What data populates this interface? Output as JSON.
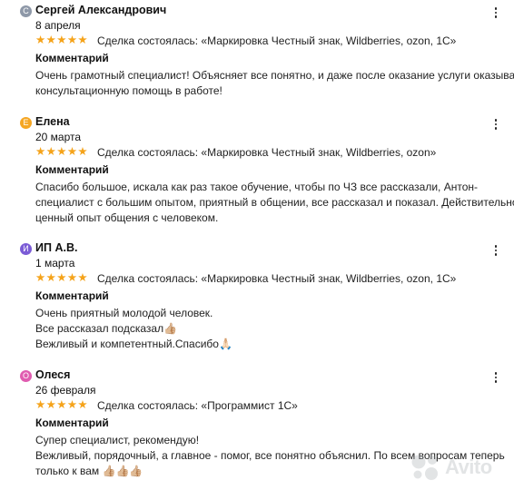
{
  "reviews": [
    {
      "name": "Сергей Александрович",
      "avatar_letter": "С",
      "avatar_color": "#8e98a8",
      "date": "8 апреля",
      "rating": 5,
      "stars": "★★★★★",
      "deal_label": "Сделка состоялась:",
      "deal_value": "«Маркировка Честный знак, Wildberries, ozon, 1С»",
      "comment_title": "Комментарий",
      "lines": [
        "Очень грамотный специалист! Объясняет все понятно, и даже после оказание услуги оказывает",
        "консультационную помощь в работе!"
      ]
    },
    {
      "name": "Елена",
      "avatar_letter": "Е",
      "avatar_color": "#f5a623",
      "date": "20 марта",
      "rating": 5,
      "stars": "★★★★★",
      "deal_label": "Сделка состоялась:",
      "deal_value": "«Маркировка Честный знак, Wildberries, ozon»",
      "comment_title": "Комментарий",
      "lines": [
        "Спасибо большое, искала как раз такое обучение, чтобы по ЧЗ все рассказали, Антон-",
        "специалист с большим опытом, приятный в общении, все рассказал и показал. Действительно",
        "ценный опыт общения с человеком."
      ]
    },
    {
      "name": "ИП А.В.",
      "avatar_letter": "И",
      "avatar_color": "#7b5cd6",
      "date": "1 марта",
      "rating": 5,
      "stars": "★★★★★",
      "deal_label": "Сделка состоялась:",
      "deal_value": "«Маркировка Честный знак, Wildberries, ozon, 1С»",
      "comment_title": "Комментарий",
      "lines": [
        "Очень приятный молодой человек.",
        "Все рассказал подсказал👍🏼",
        "Вежливый и компетентный.Спасибо🙏🏻"
      ]
    },
    {
      "name": "Олеся",
      "avatar_letter": "О",
      "avatar_color": "#e05cb0",
      "date": "26 февраля",
      "rating": 5,
      "stars": "★★★★★",
      "deal_label": "Сделка состоялась:",
      "deal_value": "«Программист 1С»",
      "comment_title": "Комментарий",
      "lines": [
        "Супер специалист, рекомендую!",
        "Вежливый, порядочный, а главное - помог, все понятно объяснил. По всем вопросам теперь",
        "только к вам 👍🏼👍🏼👍🏼"
      ]
    }
  ],
  "watermark": {
    "text": "Avito",
    "icon": "avito-logo-icon"
  }
}
